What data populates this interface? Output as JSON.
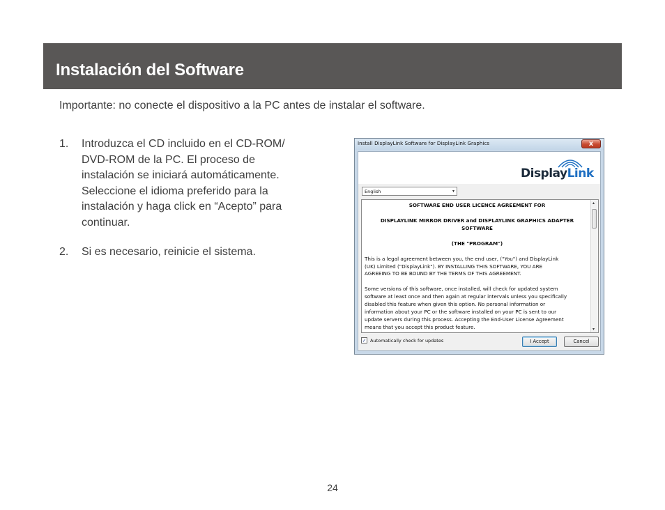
{
  "header": {
    "title": "Instalación del Software"
  },
  "important_note": "Importante: no conecte el dispositivo a la PC antes de instalar el software.",
  "steps": [
    {
      "number": "1.",
      "lines": [
        "Introduzca el CD incluido en el CD-ROM/",
        "DVD-ROM de la PC. El proceso de",
        "instalación se iniciará automáticamente.",
        "Seleccione el idioma preferido para la",
        "instalación y haga click en “Acepto” para",
        "continuar."
      ]
    },
    {
      "number": "2.",
      "lines": [
        "Si es necesario, reinicie el sistema."
      ]
    }
  ],
  "dialog": {
    "title": "Install DisplayLink Software for DisplayLink Graphics",
    "close_label": "x",
    "logo": {
      "part1": "Display",
      "part2": "Link"
    },
    "language": {
      "selected": "English",
      "arrow": "▾"
    },
    "license": {
      "heading1": "SOFTWARE END USER LICENCE AGREEMENT FOR",
      "heading2a": "DISPLAYLINK MIRROR DRIVER and DISPLAYLINK GRAPHICS ADAPTER",
      "heading2b": "SOFTWARE",
      "heading3": "(THE \"PROGRAM\")",
      "para1": [
        "This is a legal agreement between you, the end user, (\"You\") and DisplayLink",
        "(UK) Limited (\"DisplayLink\"). BY INSTALLING THIS SOFTWARE, YOU ARE",
        "AGREEING TO BE BOUND BY THE TERMS OF THIS AGREEMENT."
      ],
      "para2": [
        "Some versions of this software, once installed, will check for updated system",
        "software at least once and then again at regular intervals unless you specifically",
        "disabled this feature when given this option. No personal information or",
        "information about your PC or the software installed on your PC is sent to our",
        "update servers during this process. Accepting the End-User License Agreement",
        "means that you accept this product feature."
      ]
    },
    "scroll_up": "▴",
    "scroll_down": "▾",
    "auto_check": {
      "checked_mark": "✓",
      "label": "Automatically check for updates"
    },
    "accept_label": "I Accept",
    "cancel_label": "Cancel"
  },
  "page_number": "24",
  "colors": {
    "header_bg": "#595756",
    "logo_blue": "#1e6fc2",
    "logo_dark": "#1b2a3a"
  }
}
